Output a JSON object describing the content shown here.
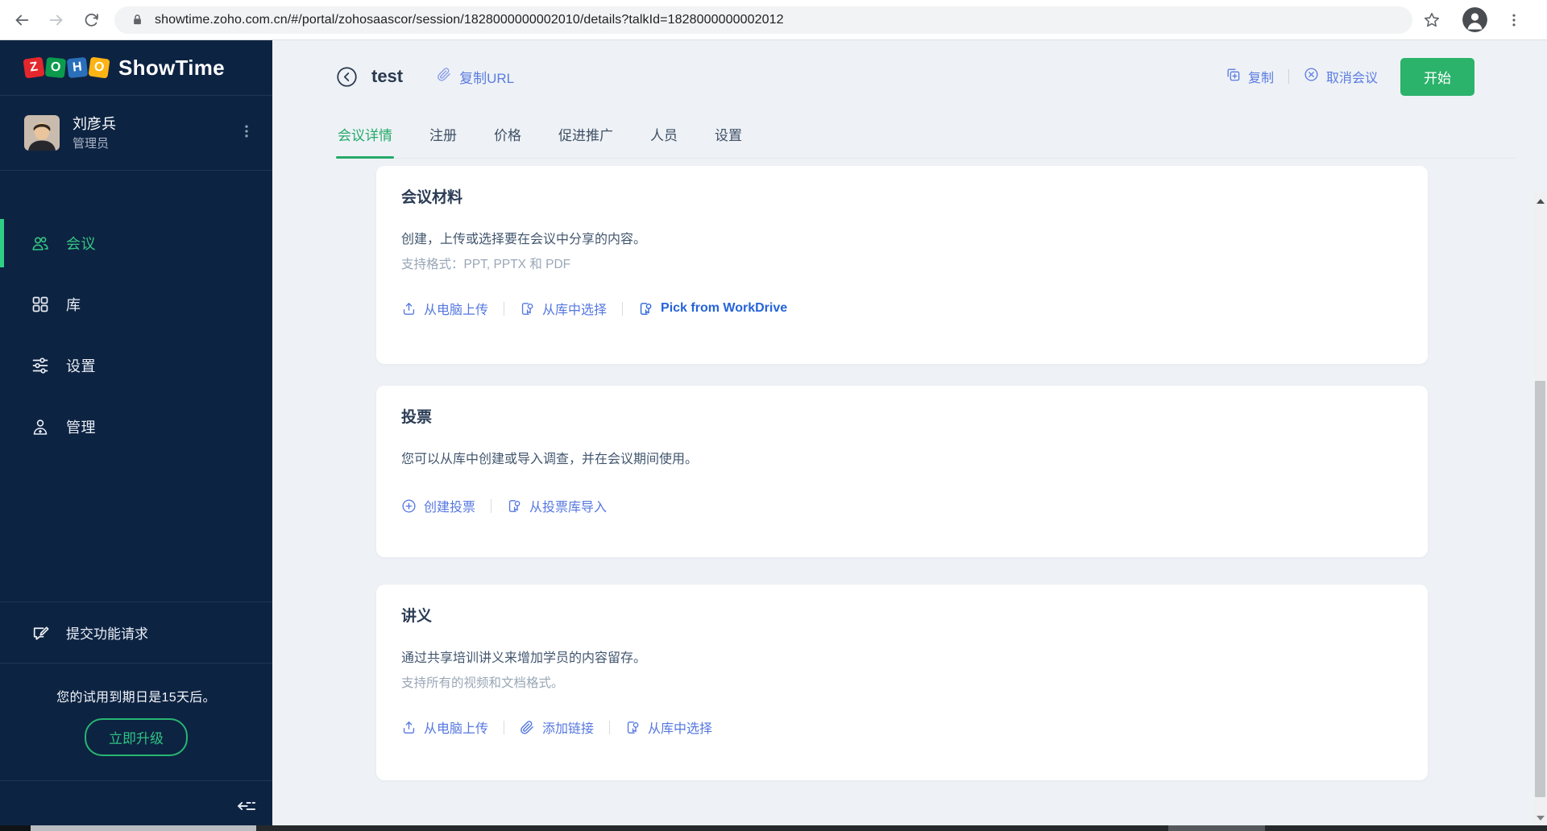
{
  "browser": {
    "url": "showtime.zoho.com.cn/#/portal/zohosaascor/session/1828000000002010/details?talkId=1828000000002012"
  },
  "sidebar": {
    "brand": {
      "letters": [
        "Z",
        "O",
        "H",
        "O"
      ],
      "name": "ShowTime"
    },
    "user": {
      "name": "刘彦兵",
      "role": "管理员"
    },
    "nav": [
      {
        "label": "会议"
      },
      {
        "label": "库"
      },
      {
        "label": "设置"
      },
      {
        "label": "管理"
      }
    ],
    "feature_request": "提交功能请求",
    "trial_note": "您的试用到期日是15天后。",
    "upgrade_label": "立即升级"
  },
  "header": {
    "title": "test",
    "copy_url_label": "复制URL",
    "copy_label": "复制",
    "cancel_label": "取消会议",
    "start_label": "开始"
  },
  "tabs": [
    {
      "label": "会议详情"
    },
    {
      "label": "注册"
    },
    {
      "label": "价格"
    },
    {
      "label": "促进推广"
    },
    {
      "label": "人员"
    },
    {
      "label": "设置"
    }
  ],
  "cards": [
    {
      "title": "会议材料",
      "desc": "创建，上传或选择要在会议中分享的内容。",
      "hint": "支持格式：PPT, PPTX 和 PDF",
      "links": [
        {
          "label": "从电脑上传"
        },
        {
          "label": "从库中选择"
        },
        {
          "label": "Pick from WorkDrive"
        }
      ]
    },
    {
      "title": "投票",
      "desc": "您可以从库中创建或导入调查，并在会议期间使用。",
      "links": [
        {
          "label": "创建投票"
        },
        {
          "label": "从投票库导入"
        }
      ]
    },
    {
      "title": "讲义",
      "desc": "通过共享培训讲义来增加学员的内容留存。",
      "hint": "支持所有的视频和文档格式。",
      "links": [
        {
          "label": "从电脑上传"
        },
        {
          "label": "添加链接"
        },
        {
          "label": "从库中选择"
        }
      ]
    }
  ],
  "colors": {
    "sidebar_bg": "#0d2342",
    "accent_green": "#2bb26b",
    "active_tab_green": "#25a969",
    "link_blue": "#5577e0",
    "workdrive_blue": "#2664d9",
    "zoho_red": "#e4272c",
    "zoho_green": "#0a9b4c",
    "zoho_blue": "#2a6fba",
    "zoho_yellow": "#fcb415"
  }
}
